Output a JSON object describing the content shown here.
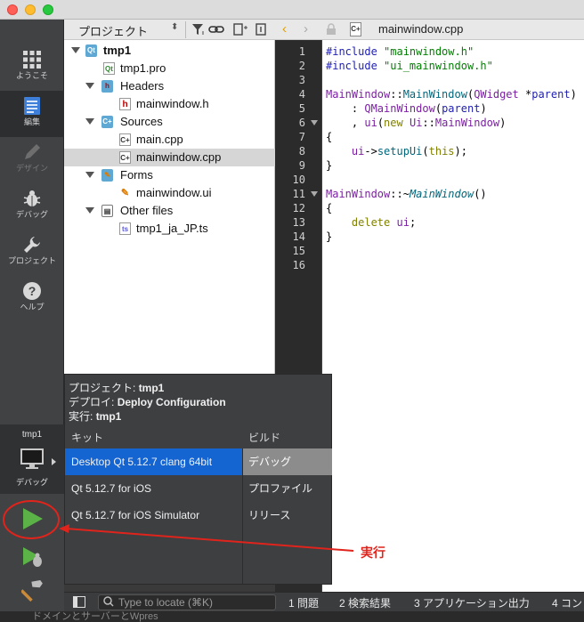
{
  "editor": {
    "filename": "mainwindow.cpp",
    "line_numbers": [
      "1",
      "2",
      "3",
      "4",
      "5",
      "6",
      "7",
      "8",
      "9",
      "10",
      "11",
      "12",
      "13",
      "14",
      "15",
      "16"
    ]
  },
  "modebar": {
    "items": [
      {
        "label": "ようこそ",
        "icon": "grid-icon"
      },
      {
        "label": "編集",
        "icon": "edit-document-icon"
      },
      {
        "label": "デザイン",
        "icon": "pencil-icon"
      },
      {
        "label": "デバッグ",
        "icon": "bug-icon"
      },
      {
        "label": "プロジェクト",
        "icon": "wrench-icon"
      },
      {
        "label": "ヘルプ",
        "icon": "help-icon"
      }
    ],
    "target": {
      "project": "tmp1",
      "mode": "デバッグ"
    }
  },
  "project_pane": {
    "selector": "プロジェクト",
    "tree": [
      {
        "text": "tmp1",
        "bold": true
      },
      {
        "text": "tmp1.pro"
      },
      {
        "text": "Headers"
      },
      {
        "text": "mainwindow.h"
      },
      {
        "text": "Sources"
      },
      {
        "text": "main.cpp"
      },
      {
        "text": "mainwindow.cpp"
      },
      {
        "text": "Forms"
      },
      {
        "text": "mainwindow.ui"
      },
      {
        "text": "Other files"
      },
      {
        "text": "tmp1_ja_JP.ts"
      }
    ]
  },
  "popup": {
    "project_label": "プロジェクト:",
    "project_value": "tmp1",
    "deploy_label": "デプロイ:",
    "deploy_value": "Deploy Configuration",
    "run_label": "実行:",
    "run_value": "tmp1",
    "kit_header": "キット",
    "build_header": "ビルド",
    "kits": [
      "Desktop Qt 5.12.7 clang 64bit",
      "Qt 5.12.7 for iOS",
      "Qt 5.12.7 for iOS Simulator"
    ],
    "builds": [
      "デバッグ",
      "プロファイル",
      "リリース"
    ]
  },
  "statusbar": {
    "locate_placeholder": "Type to locate (⌘K)",
    "tabs": [
      "1 問題",
      "2 検索結果",
      "3 アプリケーション出力",
      "4 コン"
    ]
  },
  "annotation": {
    "label": "実行",
    "color": "#e0241c"
  },
  "background_text": "ドメインとサーバーとWpres"
}
